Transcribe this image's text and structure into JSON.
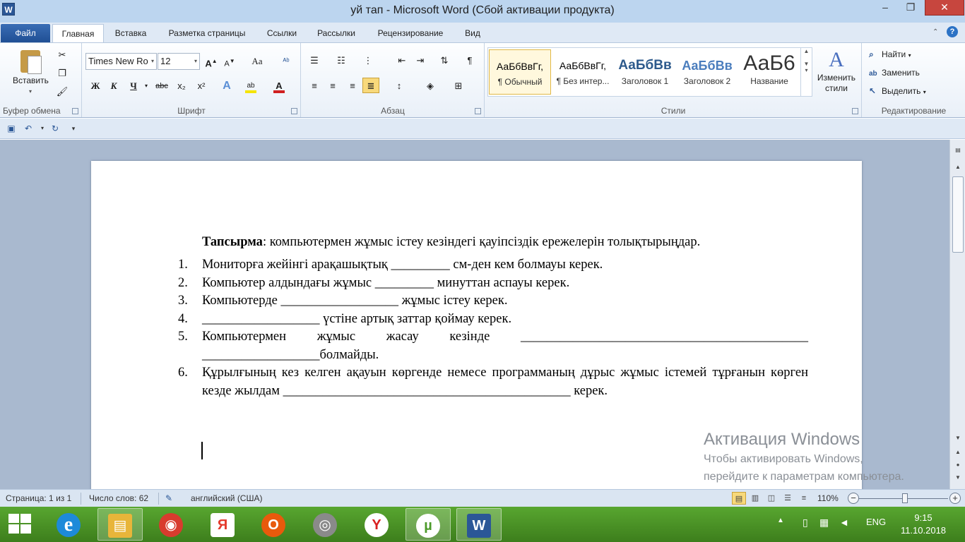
{
  "window": {
    "title": "уй тап  -  Microsoft Word (Сбой активации продукта)",
    "app_logo": "W",
    "controls": {
      "minimize": "–",
      "maximize": "❐",
      "close": "✕"
    }
  },
  "tabs": [
    {
      "label": "Файл"
    },
    {
      "label": "Главная"
    },
    {
      "label": "Вставка"
    },
    {
      "label": "Разметка страницы"
    },
    {
      "label": "Ссылки"
    },
    {
      "label": "Рассылки"
    },
    {
      "label": "Рецензирование"
    },
    {
      "label": "Вид"
    }
  ],
  "ribbon": {
    "clipboard": {
      "label": "Буфер обмена",
      "paste": "Вставить"
    },
    "font": {
      "label": "Шрифт",
      "font_name": "Times New Ro",
      "font_size": "12",
      "bold": "Ж",
      "italic": "К",
      "underline": "Ч",
      "strike": "abc",
      "subscript": "x₂",
      "superscript": "x²",
      "grow": "A",
      "shrink": "A",
      "case": "Aa",
      "font_color_letter": "A"
    },
    "paragraph": {
      "label": "Абзац",
      "pilcrow": "¶"
    },
    "styles": {
      "label": "Стили",
      "items": [
        {
          "sample": "АаБбВвГг,",
          "name": "¶ Обычный"
        },
        {
          "sample": "АаБбВвГг,",
          "name": "¶ Без интер..."
        },
        {
          "sample": "АаБбВв",
          "name": "Заголовок 1"
        },
        {
          "sample": "АаБбВв",
          "name": "Заголовок 2"
        },
        {
          "sample": "АаБ6",
          "name": "Название"
        }
      ],
      "change_styles": "Изменить стили"
    },
    "editing": {
      "label": "Редактирование",
      "find": "Найти",
      "replace": "Заменить",
      "select": "Выделить"
    }
  },
  "document": {
    "task_bold": "Тапсырма",
    "task_rest": ": компьютермен жұмыс істеу кезіндегі қауіпсіздік ережелерін толықтырыңдар.",
    "items": [
      {
        "num": "1.",
        "text": "Мониторға жейінгі арақашықтық _________ см-ден кем болмауы  керек."
      },
      {
        "num": "2.",
        "text": "Компьютер алдындағы жұмыс _________ минуттан аспауы керек."
      },
      {
        "num": "3.",
        "text": "Компьютерде __________________ жұмыс істеу керек."
      },
      {
        "num": "4.",
        "text": "__________________ үстіне артық заттар қоймау керек."
      },
      {
        "num": "5.",
        "text": "Компьютермен  жұмыс  жасау  кезінде  ____________________________________________ __________________болмайды."
      },
      {
        "num": "6.",
        "text": "Құрылғының кез келген ақауын көргенде немесе программаның дұрыс жұмыс істемей тұрғанын көрген кезде жылдам ____________________________________________ керек."
      }
    ]
  },
  "watermark": {
    "line1": "Активация Windows",
    "line2": "Чтобы активировать Windows,",
    "line3": "перейдите к параметрам компьютера."
  },
  "status": {
    "page": "Страница: 1 из 1",
    "words": "Число слов: 62",
    "language": "английский (США)",
    "zoom": "110%"
  },
  "taskbar": {
    "apps": [
      {
        "name": "internet-explorer",
        "glyph": "e",
        "color": "#1d8ad9"
      },
      {
        "name": "file-explorer",
        "glyph": "▤",
        "color": "#e8b53a"
      },
      {
        "name": "chrome",
        "glyph": "◉",
        "color": "#d83b2e"
      },
      {
        "name": "yandex",
        "glyph": "Я",
        "color": "#e43a2c"
      },
      {
        "name": "opera",
        "glyph": "O",
        "color": "#e85a0c"
      },
      {
        "name": "media-player",
        "glyph": "◎",
        "color": "#6a6a6a"
      },
      {
        "name": "yandex-browser",
        "glyph": "Y",
        "color": "#d82020"
      },
      {
        "name": "utorrent",
        "glyph": "µ",
        "color": "#4c9a2a"
      },
      {
        "name": "word",
        "glyph": "W",
        "color": "#2b5797"
      }
    ],
    "lang": "ENG",
    "time": "9:15",
    "date": "11.10.2018"
  }
}
